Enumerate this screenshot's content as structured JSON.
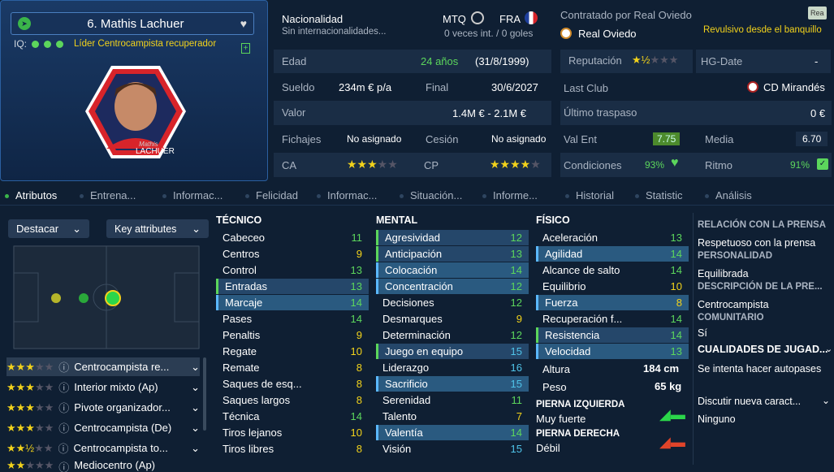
{
  "player": {
    "name": "6. Mathis Lachuer",
    "iq_label": "IQ:",
    "role": "Líder  Centrocampista recuperador",
    "photo_caption": "Mathis",
    "photo_surname": "LACHUER"
  },
  "nationality": {
    "label": "Nacionalidad",
    "sub": "Sin internacionalidades...",
    "code": "MTQ",
    "code2": "FRA",
    "caps": "0 veces int. / 0 goles"
  },
  "contract": {
    "label": "Contratado por Real Oviedo",
    "club": "Real Oviedo",
    "badge": "Rea",
    "status": "Revulsivo desde el banquillo"
  },
  "details": {
    "edad_l": "Edad",
    "edad_v": "24 años",
    "edad_d": "(31/8/1999)",
    "sueldo_l": "Sueldo",
    "sueldo_v": "234m € p/a",
    "final_l": "Final",
    "final_v": "30/6/2027",
    "valor_l": "Valor",
    "valor_v": "1.4M € - 2.1M €",
    "fich_l": "Fichajes",
    "fich_v": "No asignado",
    "ces_l": "Cesión",
    "ces_v": "No asignado",
    "ca_l": "CA",
    "cp_l": "CP"
  },
  "right": {
    "rep_l": "Reputación",
    "hg_l": "HG-Date",
    "hg_v": "-",
    "last_l": "Last Club",
    "last_v": "CD Mirandés",
    "tras_l": "Último traspaso",
    "tras_v": "0 €",
    "valent_l": "Val Ent",
    "valent_v": "7.75",
    "media_l": "Media",
    "media_v": "6.70",
    "cond_l": "Condiciones",
    "cond_v": "93%",
    "ritmo_l": "Ritmo",
    "ritmo_v": "91%"
  },
  "tabs": [
    "Atributos",
    "Entrena...",
    "Informac...",
    "Felicidad",
    "Informac...",
    "Situación...",
    "Informe...",
    "Historial",
    "Statistic",
    "Análisis"
  ],
  "left": {
    "destacar": "Destacar",
    "key": "Key attributes"
  },
  "positions": [
    "Centrocampista re...",
    "Interior mixto (Ap)",
    "Pivote organizador...",
    "Centrocampista (De)",
    "Centrocampista to...",
    "Mediocentro (Ap)"
  ],
  "tecnico": {
    "title": "TÉCNICO",
    "items": [
      [
        "Cabeceo",
        "11"
      ],
      [
        "Centros",
        "9"
      ],
      [
        "Control",
        "13"
      ],
      [
        "Entradas",
        "13"
      ],
      [
        "Marcaje",
        "14"
      ],
      [
        "Pases",
        "14"
      ],
      [
        "Penaltis",
        "9"
      ],
      [
        "Regate",
        "10"
      ],
      [
        "Remate",
        "8"
      ],
      [
        "Saques de esq...",
        "8"
      ],
      [
        "Saques largos",
        "8"
      ],
      [
        "Técnica",
        "14"
      ],
      [
        "Tiros lejanos",
        "10"
      ],
      [
        "Tiros libres",
        "8"
      ]
    ]
  },
  "mental": {
    "title": "MENTAL",
    "items": [
      [
        "Agresividad",
        "12"
      ],
      [
        "Anticipación",
        "13"
      ],
      [
        "Colocación",
        "14"
      ],
      [
        "Concentración",
        "12"
      ],
      [
        "Decisiones",
        "12"
      ],
      [
        "Desmarques",
        "9"
      ],
      [
        "Determinación",
        "12"
      ],
      [
        "Juego en equipo",
        "15"
      ],
      [
        "Liderazgo",
        "16"
      ],
      [
        "Sacrificio",
        "15"
      ],
      [
        "Serenidad",
        "11"
      ],
      [
        "Talento",
        "7"
      ],
      [
        "Valentía",
        "14"
      ],
      [
        "Visión",
        "15"
      ]
    ]
  },
  "fisico": {
    "title": "FÍSICO",
    "items": [
      [
        "Aceleración",
        "13"
      ],
      [
        "Agilidad",
        "14"
      ],
      [
        "Alcance de salto",
        "14"
      ],
      [
        "Equilibrio",
        "10"
      ],
      [
        "Fuerza",
        "8"
      ],
      [
        "Recuperación f...",
        "14"
      ],
      [
        "Resistencia",
        "14"
      ],
      [
        "Velocidad",
        "13"
      ]
    ],
    "altura_l": "Altura",
    "altura_v": "184 cm",
    "peso_l": "Peso",
    "peso_v": "65 kg",
    "pi_l": "PIERNA IZQUIERDA",
    "pi_v": "Muy fuerte",
    "pd_l": "PIERNA DERECHA",
    "pd_v": "Débil"
  },
  "rel": {
    "h1": "RELACIÓN CON LA PRENSA",
    "v1": "Respetuoso con la prensa",
    "h2": "PERSONALIDAD",
    "v2": "Equilibrada",
    "h3": "DESCRIPCIÓN DE LA PRE...",
    "v3": "Centrocampista",
    "h4": "COMUNITARIO",
    "v4": "Sí",
    "h5": "CUALIDADES DE JUGAD...",
    "v5": "Se intenta hacer autopases",
    "v6": "Discutir nueva caract...",
    "v7": "Ninguno"
  }
}
